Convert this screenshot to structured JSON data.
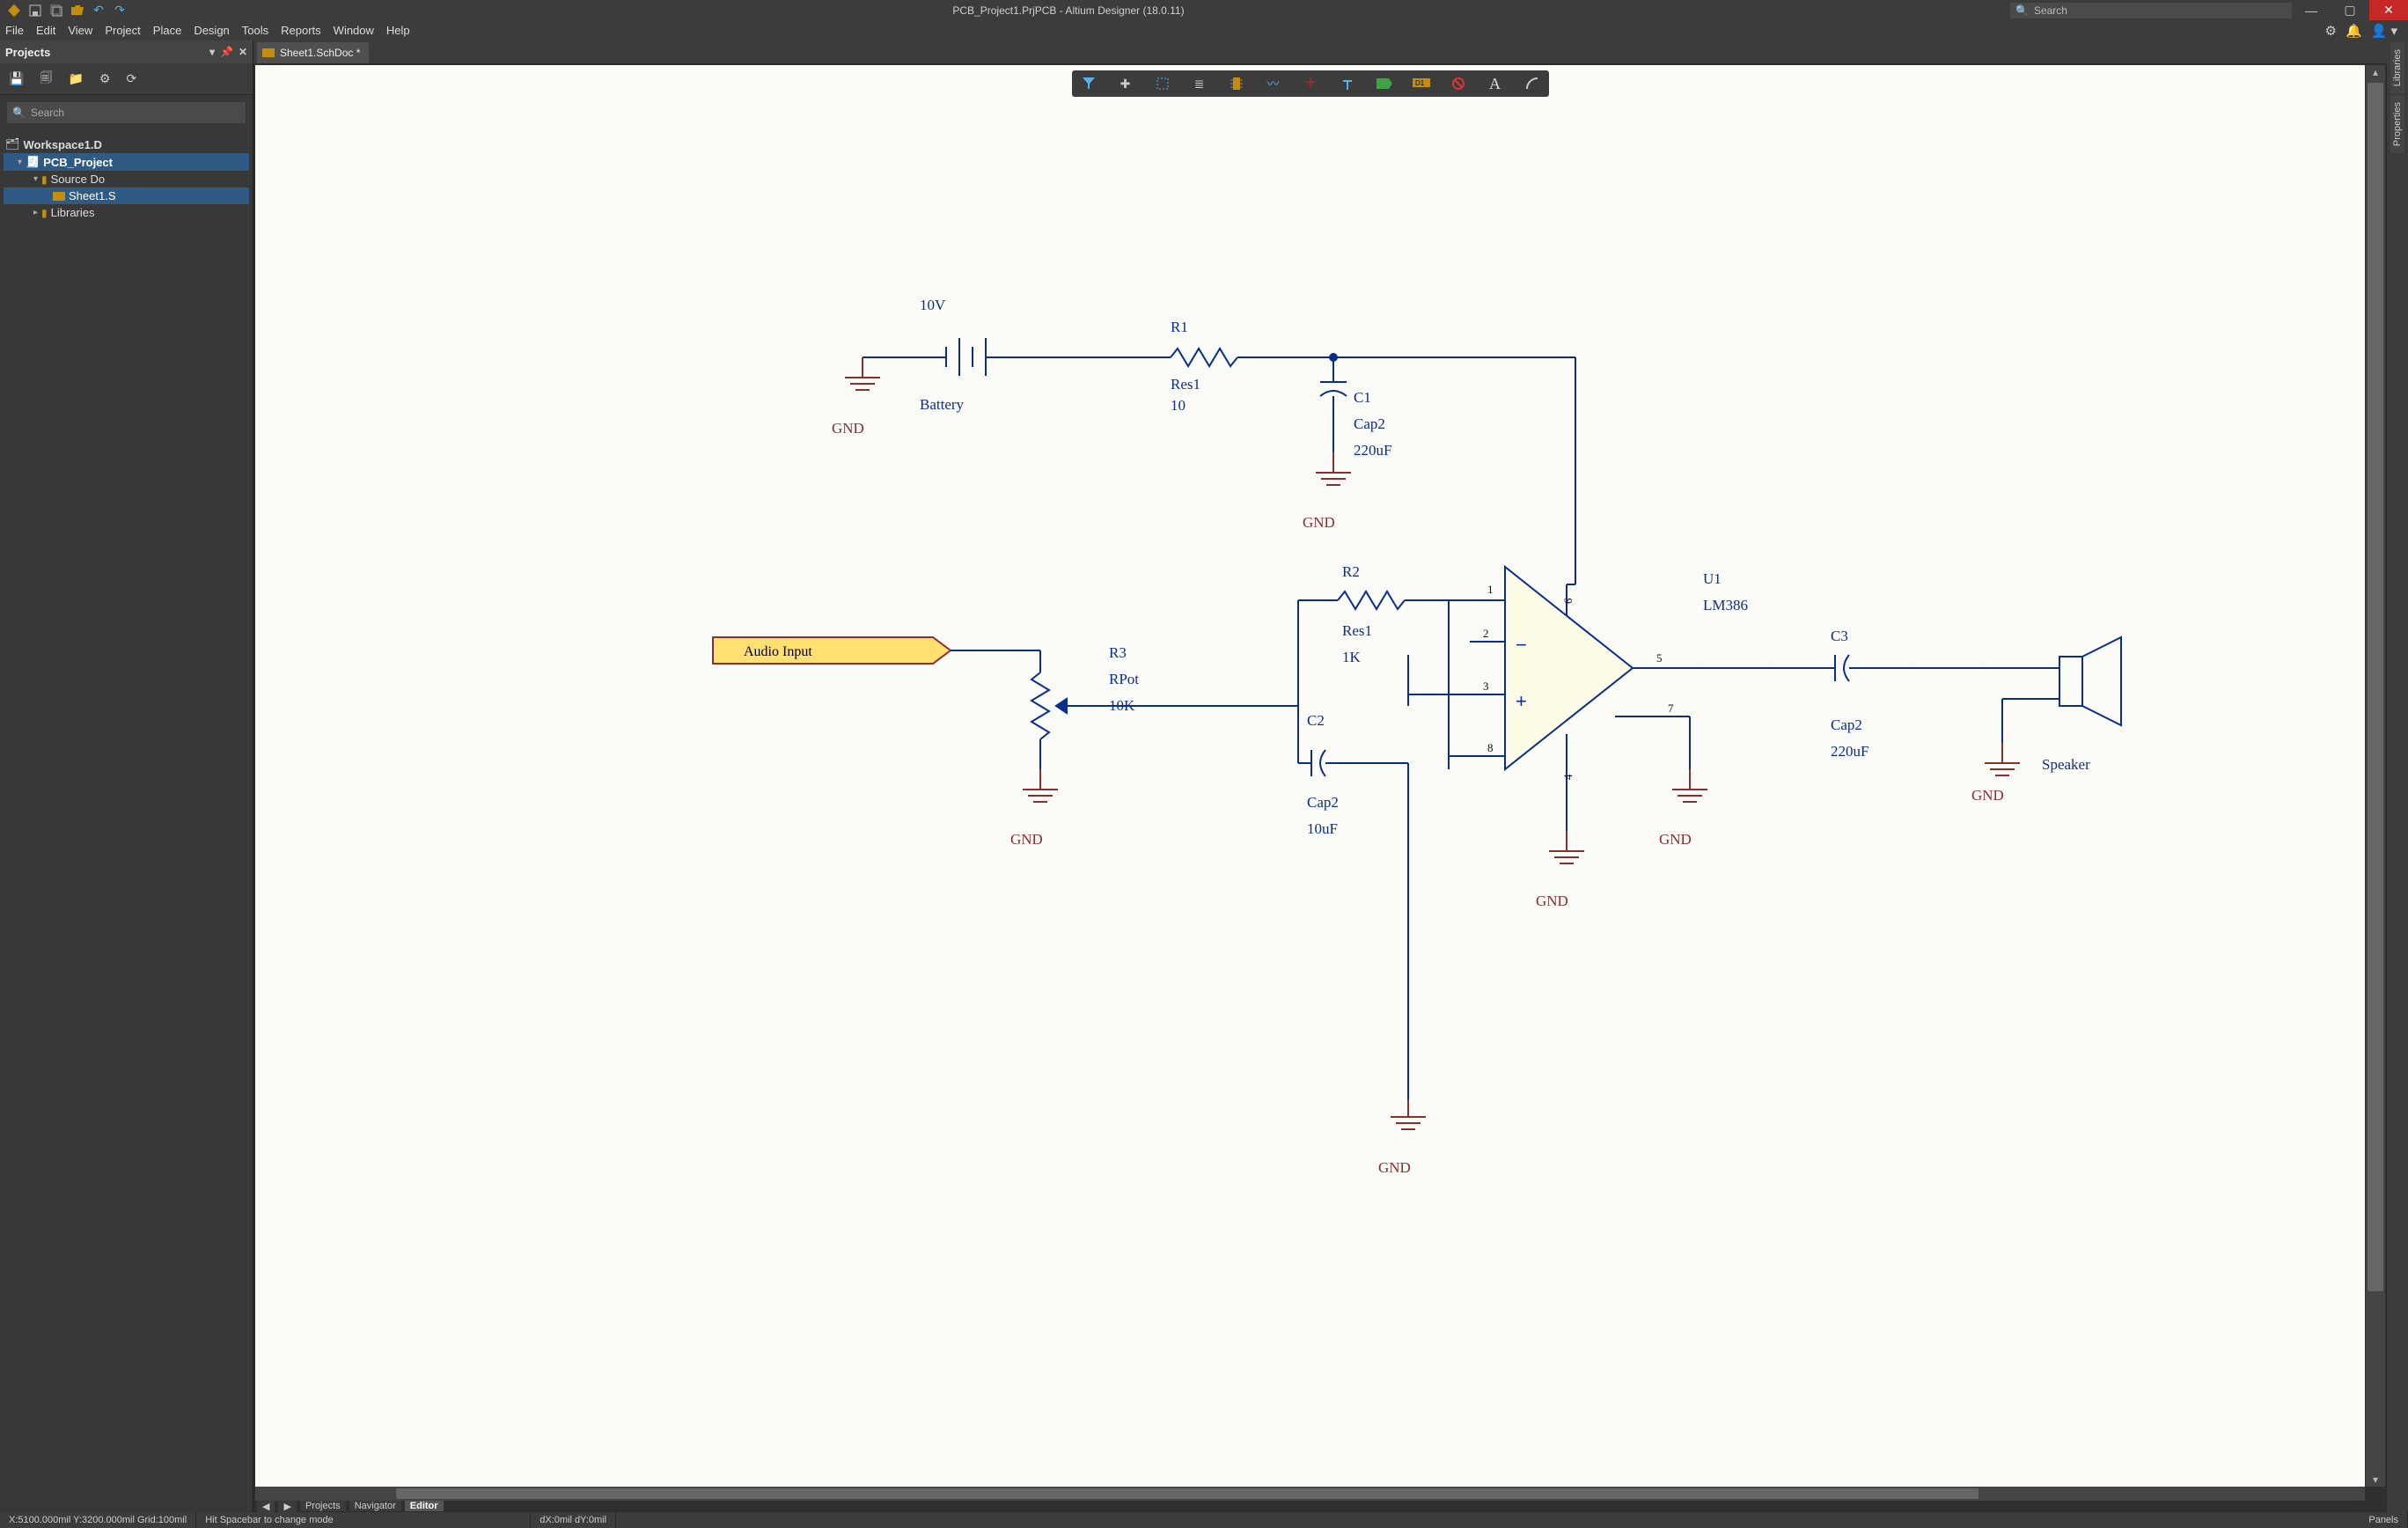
{
  "title": "PCB_Project1.PrjPCB - Altium Designer (18.0.11)",
  "search_placeholder": "Search",
  "menus": [
    "File",
    "Edit",
    "View",
    "Project",
    "Place",
    "Design",
    "Tools",
    "Reports",
    "Window",
    "Help"
  ],
  "projects_panel": {
    "title": "Projects",
    "search_placeholder": "Search",
    "workspace": "Workspace1.D",
    "project": "PCB_Project",
    "source_docs": "Source Do",
    "sheet": "Sheet1.S",
    "libraries": "Libraries"
  },
  "doc_tab": "Sheet1.SchDoc *",
  "side_tabs": [
    "Libraries",
    "Properties"
  ],
  "status": {
    "coords": "X:5100.000mil Y:3200.000mil   Grid:100mil",
    "hint": "Hit Spacebar to change mode",
    "dxy": "dX:0mil dY:0mil",
    "panels": "Panels"
  },
  "bottom_tabs": {
    "left_arrow": "◀",
    "right_arrow": "▶",
    "tabs": [
      "Projects",
      "Navigator",
      "Editor"
    ]
  },
  "schematic": {
    "port": {
      "label": "Audio Input"
    },
    "battery": {
      "designator": "10V",
      "name": "Battery"
    },
    "r1": {
      "designator": "R1",
      "name": "Res1",
      "value": "10"
    },
    "r2": {
      "designator": "R2",
      "name": "Res1",
      "value": "1K"
    },
    "r3": {
      "designator": "R3",
      "name": "RPot",
      "value": "10K"
    },
    "c1": {
      "designator": "C1",
      "name": "Cap2",
      "value": "220uF"
    },
    "c2": {
      "designator": "C2",
      "name": "Cap2",
      "value": "10uF"
    },
    "c3": {
      "designator": "C3",
      "name": "Cap2",
      "value": "220uF"
    },
    "u1": {
      "designator": "U1",
      "name": "LM386"
    },
    "speaker": {
      "name": "Speaker"
    },
    "gnd": "GND",
    "pins": {
      "p1": "1",
      "p2": "2",
      "p3": "3",
      "p4": "4",
      "p5": "5",
      "p6": "6",
      "p7": "7",
      "p8": "8"
    }
  }
}
